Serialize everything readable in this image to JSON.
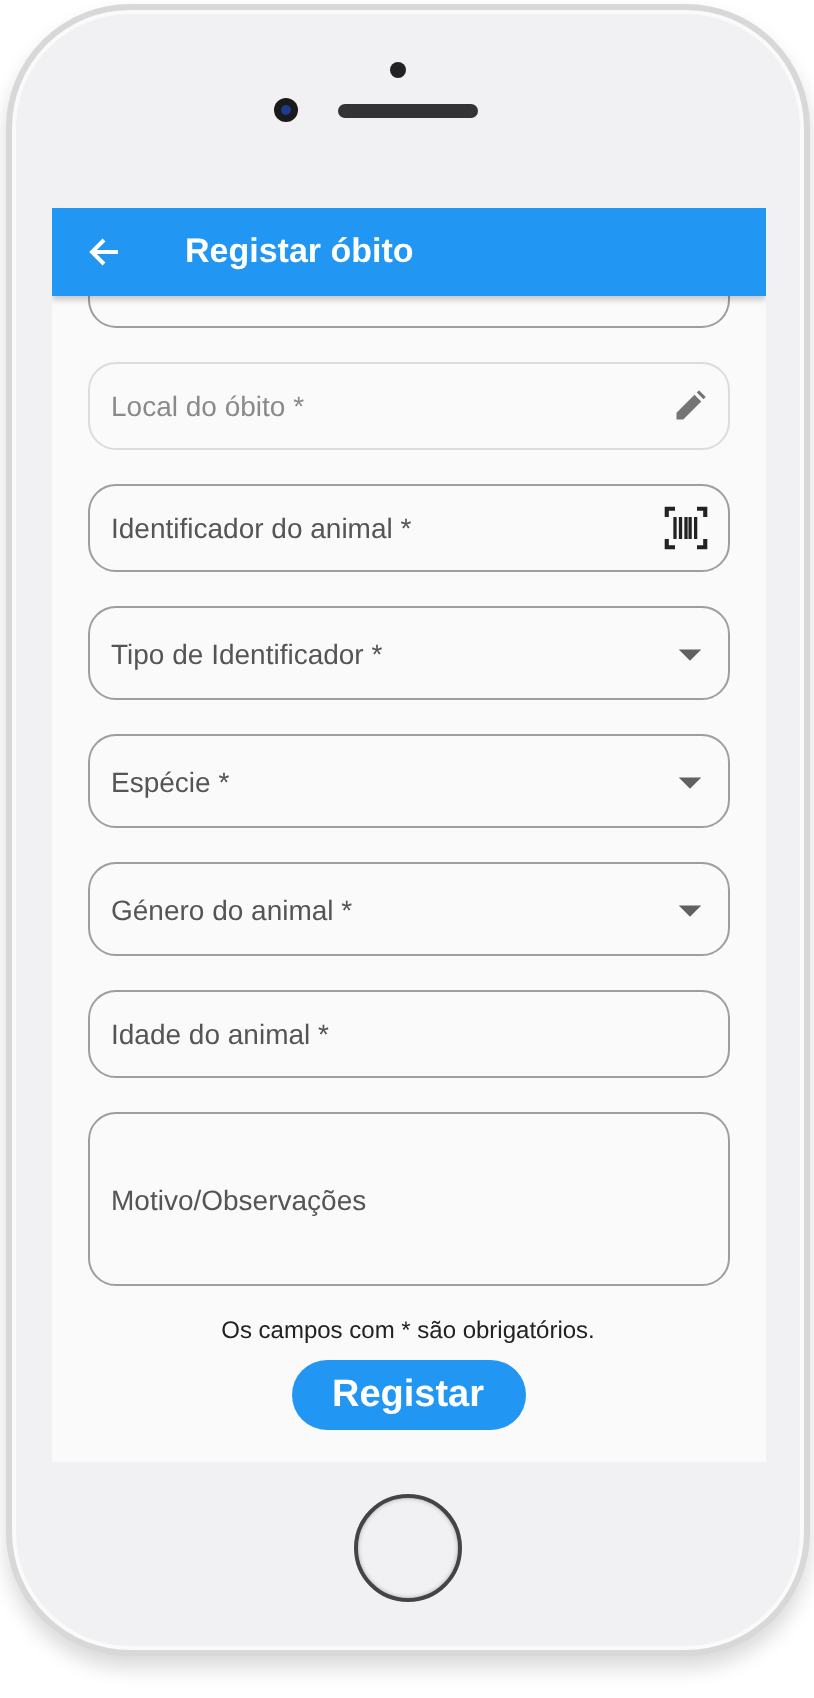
{
  "app_bar": {
    "title": "Registar óbito"
  },
  "fields": [
    {
      "kind": "cut",
      "disabled": false
    },
    {
      "kind": "edit",
      "label": "Local do óbito *",
      "disabled": true
    },
    {
      "kind": "barcode",
      "label": "Identificador do animal *",
      "disabled": false
    },
    {
      "kind": "dropdown",
      "label": "Tipo de Identificador *",
      "disabled": false
    },
    {
      "kind": "dropdown",
      "label": "Espécie *",
      "disabled": false
    },
    {
      "kind": "dropdown",
      "label": "Género do animal *",
      "disabled": false
    },
    {
      "kind": "text",
      "label": "Idade do animal *",
      "disabled": false
    },
    {
      "kind": "multiline",
      "label": "Motivo/Observações",
      "disabled": false
    }
  ],
  "note": "Os campos com * são obrigatórios.",
  "submit_button": "Registar"
}
